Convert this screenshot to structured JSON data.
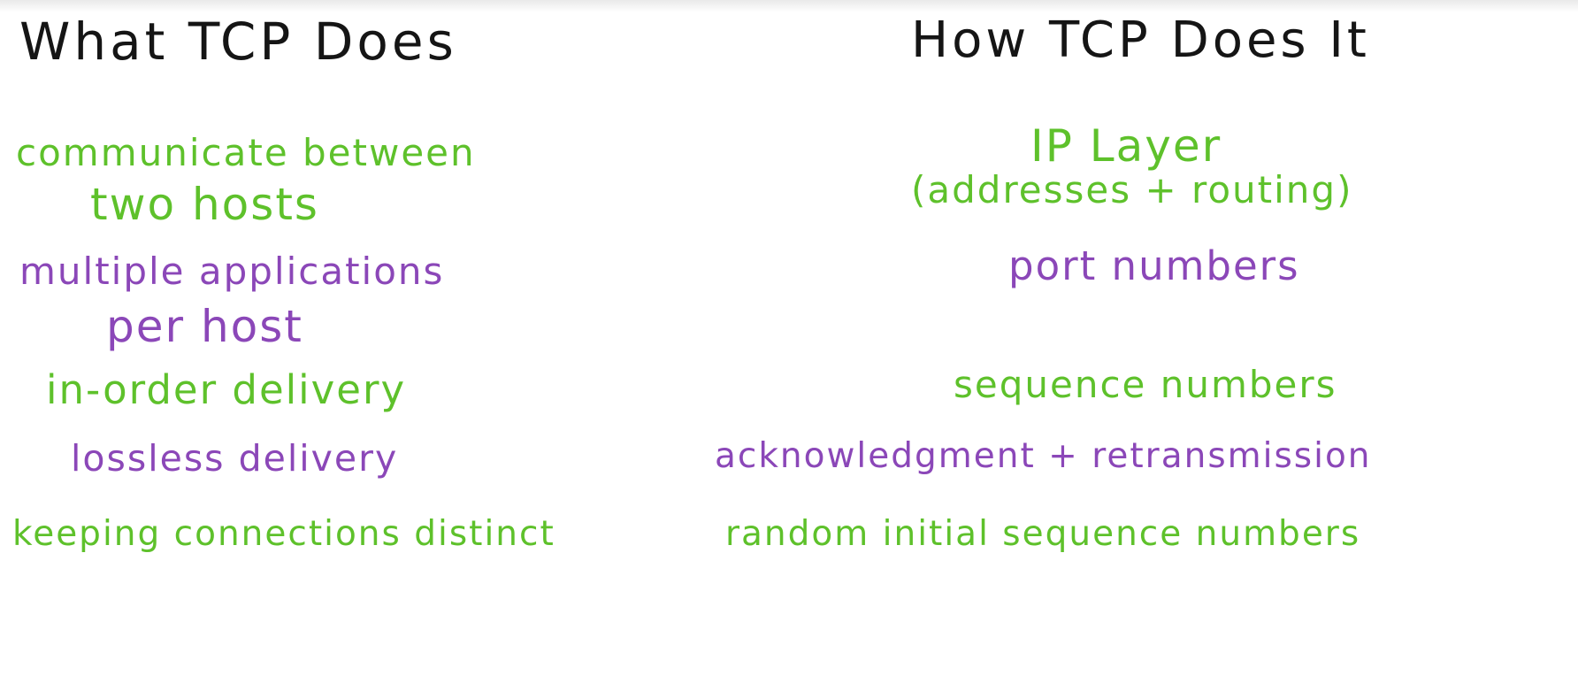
{
  "colors": {
    "background": "#ffffff",
    "heading_ink": "#151515",
    "green_ink": "#5ec12b",
    "purple_ink": "#8b47b8"
  },
  "headings": {
    "left": "What TCP Does",
    "right": "How TCP Does It"
  },
  "what_tcp_does": [
    {
      "line1": "communicate between",
      "line2": "two hosts",
      "color": "green"
    },
    {
      "line1": "multiple applications",
      "line2": "per host",
      "color": "purple"
    },
    {
      "line1": "in-order delivery",
      "color": "green"
    },
    {
      "line1": "lossless delivery",
      "color": "purple"
    },
    {
      "line1": "keeping connections distinct",
      "color": "green"
    }
  ],
  "how_tcp_does_it": [
    {
      "line1": "IP Layer",
      "line2": "(addresses + routing)",
      "color": "green"
    },
    {
      "line1": "port numbers",
      "color": "purple"
    },
    {
      "line1": "sequence numbers",
      "color": "green"
    },
    {
      "line1": "acknowledgment + retransmission",
      "color": "purple"
    },
    {
      "line1": "random initial sequence numbers",
      "color": "green"
    }
  ]
}
